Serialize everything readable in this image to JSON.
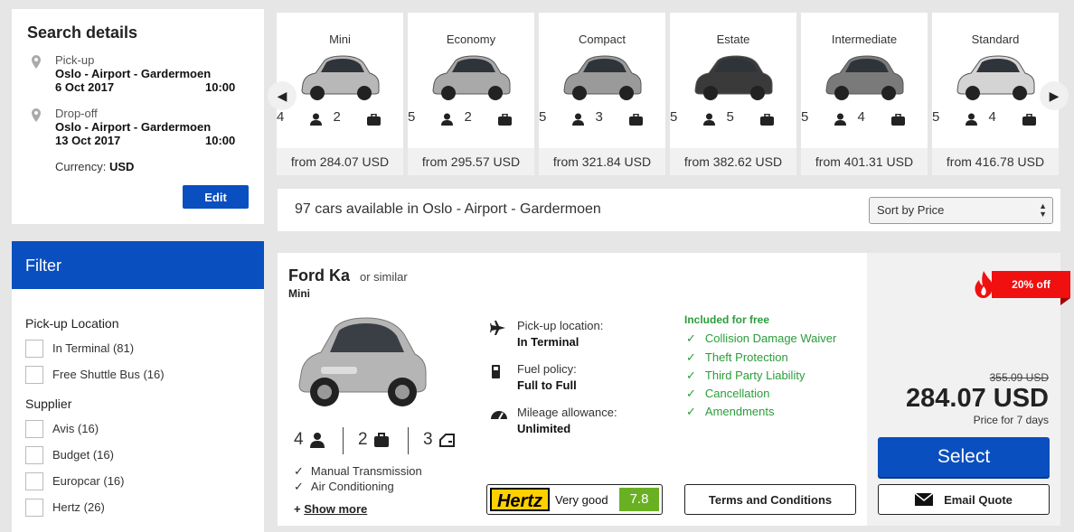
{
  "search": {
    "title": "Search details",
    "pickup": {
      "label": "Pick-up",
      "place": "Oslo - Airport - Gardermoen",
      "date": "6 Oct 2017",
      "time": "10:00"
    },
    "dropoff": {
      "label": "Drop-off",
      "place": "Oslo - Airport - Gardermoen",
      "date": "13 Oct 2017",
      "time": "10:00"
    },
    "currency_label": "Currency:",
    "currency_value": "USD",
    "edit_label": "Edit"
  },
  "filter": {
    "title": "Filter",
    "pickup_location": {
      "title": "Pick-up Location",
      "options": [
        "In Terminal (81)",
        "Free Shuttle Bus (16)"
      ]
    },
    "supplier": {
      "title": "Supplier",
      "options": [
        "Avis (16)",
        "Budget (16)",
        "Europcar (16)",
        "Hertz (26)"
      ]
    }
  },
  "car_classes": [
    {
      "name": "Mini",
      "seats": "4",
      "bags": "2",
      "price": "from 284.07 USD",
      "color": "#b8b8b8"
    },
    {
      "name": "Economy",
      "seats": "5",
      "bags": "2",
      "price": "from 295.57 USD",
      "color": "#a9a9a9"
    },
    {
      "name": "Compact",
      "seats": "5",
      "bags": "3",
      "price": "from 321.84 USD",
      "color": "#9a9a9a"
    },
    {
      "name": "Estate",
      "seats": "5",
      "bags": "5",
      "price": "from 382.62 USD",
      "color": "#3a3a3a"
    },
    {
      "name": "Intermediate",
      "seats": "5",
      "bags": "4",
      "price": "from 401.31 USD",
      "color": "#7a7a7a"
    },
    {
      "name": "Standard",
      "seats": "5",
      "bags": "4",
      "price": "from 416.78 USD",
      "color": "#d4d4d4"
    }
  ],
  "results": {
    "count_text": "97 cars available in Oslo - Airport - Gardermoen",
    "sort_label": "Sort by Price"
  },
  "offer": {
    "model": "Ford Ka",
    "similar": "or similar",
    "car_class": "Mini",
    "seats": "4",
    "bags": "2",
    "doors": "3",
    "features": [
      "Manual Transmission",
      "Air Conditioning"
    ],
    "show_more": "Show more",
    "pickup_label": "Pick-up location:",
    "pickup_value": "In Terminal",
    "fuel_label": "Fuel policy:",
    "fuel_value": "Full to Full",
    "mileage_label": "Mileage allowance:",
    "mileage_value": "Unlimited",
    "included_title": "Included for free",
    "included": [
      "Collision Damage Waiver",
      "Theft Protection",
      "Third Party Liability",
      "Cancellation",
      "Amendments"
    ],
    "supplier_logo": "Hertz",
    "rating_text": "Very good",
    "rating_score": "7.8",
    "terms_label": "Terms and Conditions",
    "discount": "20% off",
    "old_price": "355.09 USD",
    "price": "284.07 USD",
    "price_period": "Price for 7 days",
    "select_label": "Select",
    "email_label": "Email Quote"
  },
  "colors": {
    "brand_blue": "#0a4fbf",
    "green": "#2a9d3a",
    "rating_green": "#6ab023",
    "discount_red": "#f01010",
    "hertz_yellow": "#ffd000"
  }
}
